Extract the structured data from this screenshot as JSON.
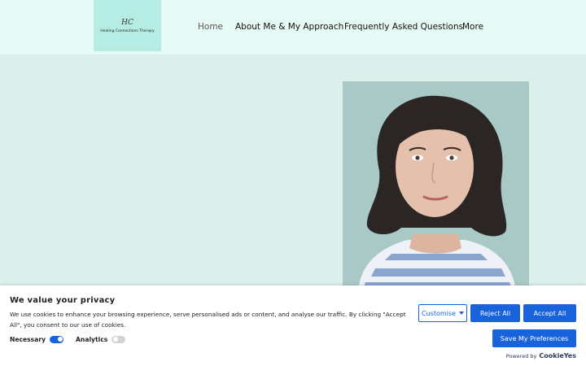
{
  "logo": {
    "mark": "HC",
    "name": "Healing Connections Therapy"
  },
  "nav": {
    "items": [
      {
        "label": "Home",
        "active": true
      },
      {
        "label": "About Me & My Approach",
        "active": false
      },
      {
        "label": "Frequently Asked Questions",
        "active": false
      },
      {
        "label": "More",
        "active": false
      }
    ]
  },
  "cookie_banner": {
    "title": "We value your privacy",
    "text": "We use cookies to enhance your browsing experience, serve personalised ads or content, and analyse our traffic. By clicking \"Accept All\", you consent to our use of cookies.",
    "toggles": [
      {
        "label": "Necessary",
        "state": "on"
      },
      {
        "label": "Analytics",
        "state": "off"
      }
    ],
    "buttons": {
      "customise": "Customise",
      "reject": "Reject All",
      "accept": "Accept All",
      "save": "Save My Preferences"
    },
    "powered_by": "Powered by",
    "brand": "CookieYes"
  },
  "colors": {
    "accent": "#1863dc",
    "header_bg": "#e6faf6",
    "page_bg": "#dcefeb",
    "logo_bg": "#b5ece4"
  }
}
